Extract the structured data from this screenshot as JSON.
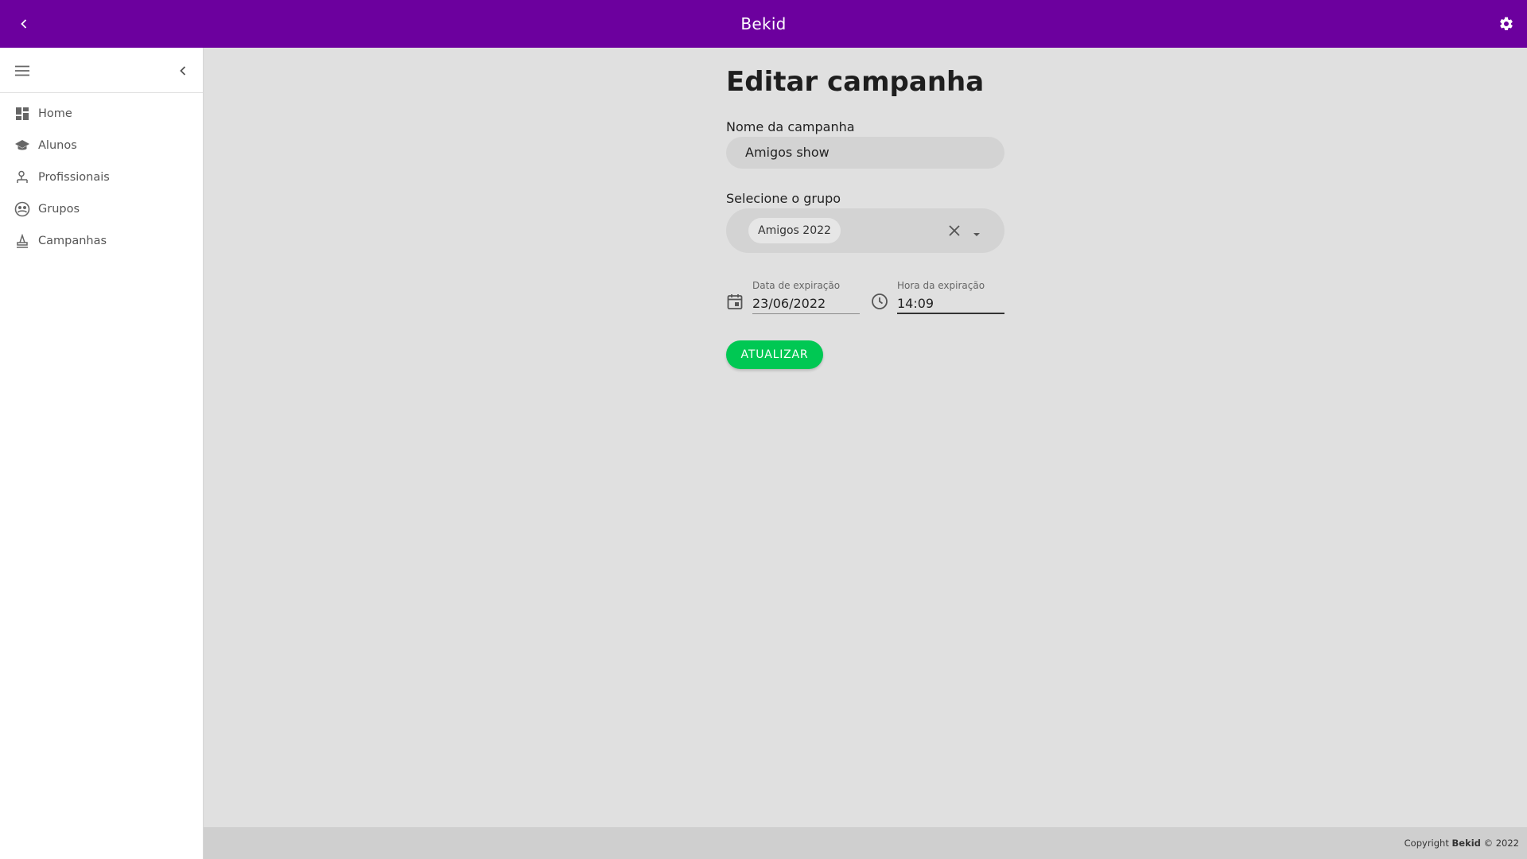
{
  "app": {
    "title": "Bekid"
  },
  "sidebar": {
    "items": [
      {
        "label": "Home",
        "icon": "dashboard-icon"
      },
      {
        "label": "Alunos",
        "icon": "school-icon"
      },
      {
        "label": "Profissionais",
        "icon": "person-desk-icon"
      },
      {
        "label": "Grupos",
        "icon": "group-icon"
      },
      {
        "label": "Campanhas",
        "icon": "campaign-icon"
      }
    ]
  },
  "form": {
    "title": "Editar campanha",
    "name_label": "Nome da campanha",
    "name_value": "Amigos show",
    "group_label": "Selecione o grupo",
    "group_selected": "Amigos 2022",
    "date_label": "Data de expiração",
    "date_value": "23/06/2022",
    "time_label": "Hora da expiração",
    "time_value": "14:09",
    "submit_label": "ATUALIZAR"
  },
  "footer": {
    "prefix": "Copyright",
    "brand": "Bekid",
    "suffix": "© 2022"
  },
  "colors": {
    "header": "#6c009e",
    "button": "#00c853",
    "background": "#e0e0e0"
  }
}
